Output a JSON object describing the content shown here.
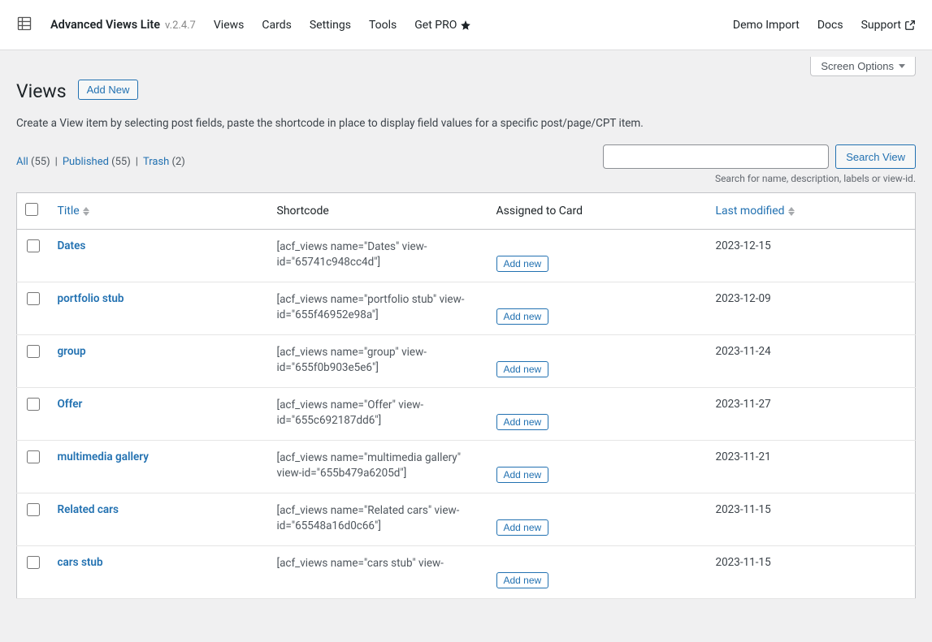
{
  "toolbar": {
    "app_name": "Advanced Views Lite",
    "version": "v.2.4.7",
    "nav": [
      "Views",
      "Cards",
      "Settings",
      "Tools"
    ],
    "get_pro": "Get PRO",
    "right_nav": {
      "demo_import": "Demo Import",
      "docs": "Docs",
      "support": "Support"
    }
  },
  "screen_options": "Screen Options",
  "page": {
    "title": "Views",
    "add_new": "Add New",
    "description": "Create a View item by selecting post fields, paste the shortcode in place to display field values for a specific post/page/CPT item."
  },
  "filters": {
    "all": {
      "label": "All",
      "count": "(55)"
    },
    "published": {
      "label": "Published",
      "count": "(55)"
    },
    "trash": {
      "label": "Trash",
      "count": "(2)"
    }
  },
  "search": {
    "button": "Search View",
    "hint": "Search for name, description, labels or view-id."
  },
  "table": {
    "headers": {
      "title": "Title",
      "shortcode": "Shortcode",
      "assigned": "Assigned to Card",
      "modified": "Last modified"
    },
    "add_new_small": "Add new",
    "rows": [
      {
        "title": "Dates",
        "shortcode": "[acf_views name=\"Dates\" view-id=\"65741c948cc4d\"]",
        "modified": "2023-12-15"
      },
      {
        "title": "portfolio stub",
        "shortcode": "[acf_views name=\"portfolio stub\" view-id=\"655f46952e98a\"]",
        "modified": "2023-12-09"
      },
      {
        "title": "group",
        "shortcode": "[acf_views name=\"group\" view-id=\"655f0b903e5e6\"]",
        "modified": "2023-11-24"
      },
      {
        "title": "Offer",
        "shortcode": "[acf_views name=\"Offer\" view-id=\"655c692187dd6\"]",
        "modified": "2023-11-27"
      },
      {
        "title": "multimedia gallery",
        "shortcode": "[acf_views name=\"multimedia gallery\" view-id=\"655b479a6205d\"]",
        "modified": "2023-11-21"
      },
      {
        "title": "Related cars",
        "shortcode": "[acf_views name=\"Related cars\" view-id=\"65548a16d0c66\"]",
        "modified": "2023-11-15"
      },
      {
        "title": "cars stub",
        "shortcode": "[acf_views name=\"cars stub\" view-",
        "modified": "2023-11-15"
      }
    ]
  }
}
